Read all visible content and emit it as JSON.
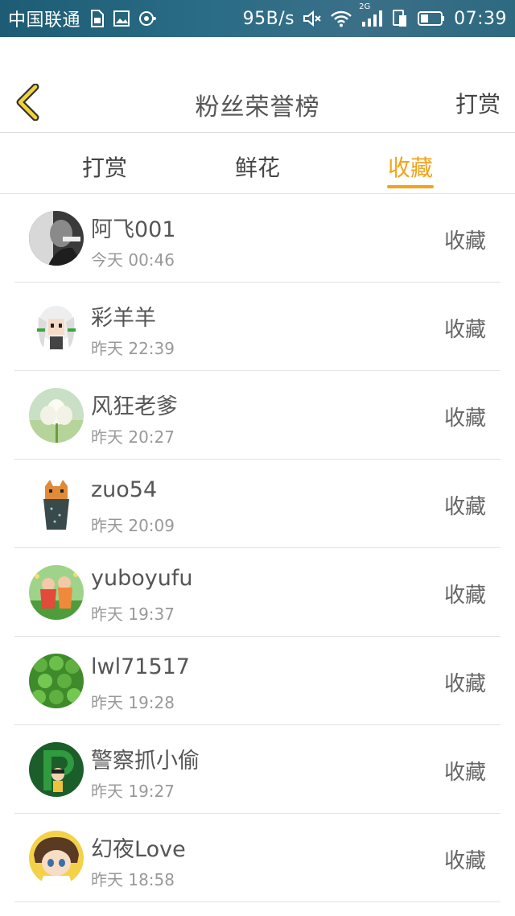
{
  "status_bar": {
    "carrier": "中国联通",
    "speed": "95B/s",
    "network": "2G",
    "time": "07:39",
    "icons": [
      "sim-icon",
      "image-icon",
      "notification-icon",
      "mute-icon",
      "wifi-icon",
      "signal-icon",
      "sim2-icon",
      "battery-icon"
    ]
  },
  "header": {
    "title": "粉丝荣誉榜",
    "action": "打赏",
    "back_icon": "chevron-left-icon"
  },
  "tabs": [
    {
      "label": "打赏",
      "active": false
    },
    {
      "label": "鲜花",
      "active": false
    },
    {
      "label": "收藏",
      "active": true
    }
  ],
  "colors": {
    "accent": "#f3a31a",
    "status_bar": "#2a6c86"
  },
  "fans": [
    {
      "name": "阿飞001",
      "time": "今天 00:46",
      "action": "收藏"
    },
    {
      "name": "彩羊羊",
      "time": "昨天 22:39",
      "action": "收藏"
    },
    {
      "name": "风狂老爹",
      "time": "昨天 20:27",
      "action": "收藏"
    },
    {
      "name": "zuo54",
      "time": "昨天 20:09",
      "action": "收藏"
    },
    {
      "name": "yuboyufu",
      "time": "昨天 19:37",
      "action": "收藏"
    },
    {
      "name": "lwl71517",
      "time": "昨天 19:28",
      "action": "收藏"
    },
    {
      "name": "警察抓小偷",
      "time": "昨天 19:27",
      "action": "收藏"
    },
    {
      "name": "幻夜Love",
      "time": "昨天 18:58",
      "action": "收藏"
    }
  ]
}
